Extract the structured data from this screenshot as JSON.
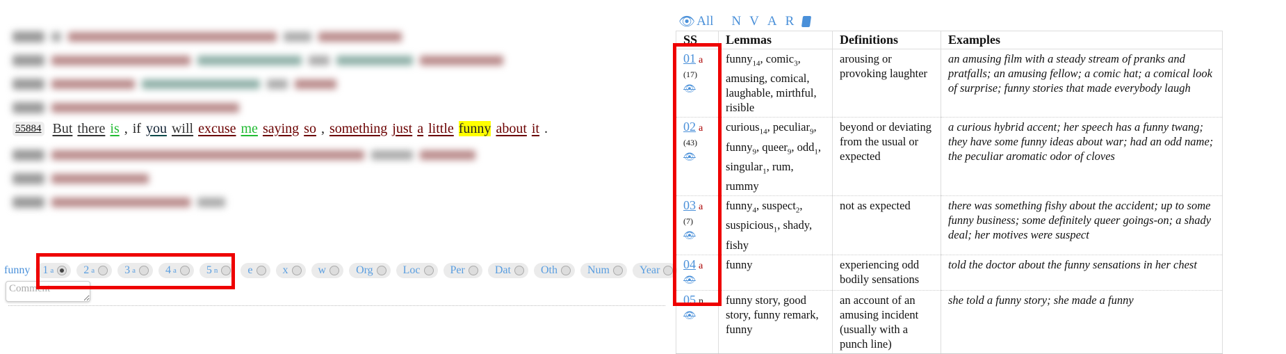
{
  "sentence": {
    "id": "55884",
    "words": [
      {
        "text": "But",
        "style": "dark"
      },
      {
        "text": "there",
        "style": "dark"
      },
      {
        "text": "is",
        "style": "green"
      },
      {
        "text": ",",
        "style": "plain"
      },
      {
        "text": "if",
        "style": "plain"
      },
      {
        "text": "you",
        "style": "teal"
      },
      {
        "text": "will",
        "style": "dark"
      },
      {
        "text": "excuse",
        "style": "red"
      },
      {
        "text": "me",
        "style": "green"
      },
      {
        "text": "saying",
        "style": "red"
      },
      {
        "text": "so",
        "style": "red"
      },
      {
        "text": ",",
        "style": "plain"
      },
      {
        "text": "something",
        "style": "red"
      },
      {
        "text": "just",
        "style": "red"
      },
      {
        "text": "a",
        "style": "red"
      },
      {
        "text": "little",
        "style": "red"
      },
      {
        "text": "funny",
        "style": "hl"
      },
      {
        "text": "about",
        "style": "red"
      },
      {
        "text": "it",
        "style": "red"
      },
      {
        "text": ".",
        "style": "plain"
      }
    ]
  },
  "tagger": {
    "lemma": "funny",
    "options": [
      {
        "label": "1",
        "sub": "a",
        "selected": true
      },
      {
        "label": "2",
        "sub": "a",
        "selected": false
      },
      {
        "label": "3",
        "sub": "a",
        "selected": false
      },
      {
        "label": "4",
        "sub": "a",
        "selected": false
      },
      {
        "label": "5",
        "sub": "n",
        "selected": false
      },
      {
        "label": "e",
        "sub": "",
        "selected": false
      },
      {
        "label": "x",
        "sub": "",
        "selected": false
      },
      {
        "label": "w",
        "sub": "",
        "selected": false
      },
      {
        "label": "Org",
        "sub": "",
        "selected": false
      },
      {
        "label": "Loc",
        "sub": "",
        "selected": false
      },
      {
        "label": "Per",
        "sub": "",
        "selected": false
      },
      {
        "label": "Dat",
        "sub": "",
        "selected": false
      },
      {
        "label": "Oth",
        "sub": "",
        "selected": false
      },
      {
        "label": "Num",
        "sub": "",
        "selected": false
      },
      {
        "label": "Year",
        "sub": "",
        "selected": false
      }
    ],
    "comment_placeholder": "Comment"
  },
  "toolbar": {
    "all_label": "All",
    "filters": [
      "N",
      "V",
      "A",
      "R"
    ],
    "accent": "#4a90d9"
  },
  "table": {
    "headers": [
      "SS",
      "Lemmas",
      "Definitions",
      "Examples"
    ],
    "rows": [
      {
        "ss": "01",
        "pos": "a",
        "count": "(17)",
        "lemmas": [
          {
            "t": "funny",
            "s": "14"
          },
          {
            "t": "comic",
            "s": "3"
          },
          {
            "t": "amusing"
          },
          {
            "t": "comical"
          },
          {
            "t": "laughable"
          },
          {
            "t": "mirthful"
          },
          {
            "t": "risible"
          }
        ],
        "definition": "arousing or provoking laughter",
        "examples": "an amusing film with a steady stream of pranks and pratfalls; an amusing fellow; a comic hat; a comical look of surprise; funny stories that made everybody laugh"
      },
      {
        "ss": "02",
        "pos": "a",
        "count": "(43)",
        "lemmas": [
          {
            "t": "curious",
            "s": "14"
          },
          {
            "t": "peculiar",
            "s": "9"
          },
          {
            "t": "funny",
            "s": "9"
          },
          {
            "t": "queer",
            "s": "9"
          },
          {
            "t": "odd",
            "s": "1"
          },
          {
            "t": "singular",
            "s": "1"
          },
          {
            "t": "rum"
          },
          {
            "t": "rummy"
          }
        ],
        "definition": "beyond or deviating from the usual or expected",
        "examples": "a curious hybrid accent; her speech has a funny twang; they have some funny ideas about war; had an odd name; the peculiar aromatic odor of cloves"
      },
      {
        "ss": "03",
        "pos": "a",
        "count": "(7)",
        "lemmas": [
          {
            "t": "funny",
            "s": "4"
          },
          {
            "t": "suspect",
            "s": "2"
          },
          {
            "t": "suspicious",
            "s": "1"
          },
          {
            "t": "shady"
          },
          {
            "t": "fishy"
          }
        ],
        "definition": "not as expected",
        "examples": "there was something fishy about the accident; up to some funny business; some definitely queer goings-on; a shady deal; her motives were suspect"
      },
      {
        "ss": "04",
        "pos": "a",
        "count": "",
        "lemmas": [
          {
            "t": "funny"
          }
        ],
        "definition": "experiencing odd bodily sensations",
        "examples": "told the doctor about the funny sensations in her chest"
      },
      {
        "ss": "05",
        "pos": "n",
        "count": "",
        "lemmas": [
          {
            "t": "funny story"
          },
          {
            "t": "good story"
          },
          {
            "t": "funny remark"
          },
          {
            "t": "funny"
          }
        ],
        "definition": "an account of an amusing incident (usually with a punch line)",
        "examples": "she told a funny story; she made a funny"
      }
    ]
  },
  "colors": {
    "highlight_box": "#ee0000",
    "target_highlight": "#ffff00",
    "link": "#4a90d9",
    "pos_adj": "#aa0000"
  }
}
